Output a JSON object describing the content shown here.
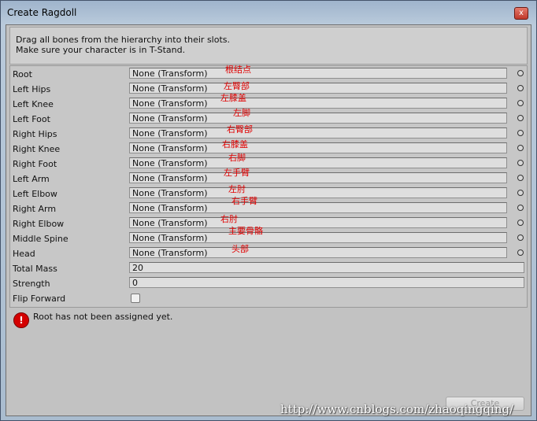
{
  "window": {
    "title": "Create Ragdoll",
    "close_label": "x"
  },
  "help": {
    "line1": "Drag all bones from the hierarchy into their slots.",
    "line2": "Make sure your character is in T-Stand."
  },
  "bones": [
    {
      "label": "Root",
      "value": "None (Transform)",
      "note": "根结点"
    },
    {
      "label": "Left Hips",
      "value": "None (Transform)",
      "note": "左臀部"
    },
    {
      "label": "Left Knee",
      "value": "None (Transform)",
      "note": "左膝盖"
    },
    {
      "label": "Left Foot",
      "value": "None (Transform)",
      "note": "左脚"
    },
    {
      "label": "Right Hips",
      "value": "None (Transform)",
      "note": "右臀部"
    },
    {
      "label": "Right Knee",
      "value": "None (Transform)",
      "note": "右膝盖"
    },
    {
      "label": "Right Foot",
      "value": "None (Transform)",
      "note": "右脚"
    },
    {
      "label": "Left Arm",
      "value": "None (Transform)",
      "note": "左手臂"
    },
    {
      "label": "Left Elbow",
      "value": "None (Transform)",
      "note": "左肘"
    },
    {
      "label": "Right Arm",
      "value": "None (Transform)",
      "note": "右手臂"
    },
    {
      "label": "Right Elbow",
      "value": "None (Transform)",
      "note": "右肘"
    },
    {
      "label": "Middle Spine",
      "value": "None (Transform)",
      "note": "主要骨骼"
    },
    {
      "label": "Head",
      "value": "None (Transform)",
      "note": "头部"
    }
  ],
  "total_mass": {
    "label": "Total Mass",
    "value": "20"
  },
  "strength": {
    "label": "Strength",
    "value": "0"
  },
  "flip_forward": {
    "label": "Flip Forward",
    "checked": false
  },
  "error": {
    "message": "Root has not been assigned yet."
  },
  "create_button": {
    "label": "Create"
  },
  "watermark": "http://www.cnblogs.com/zhaoqingqing/"
}
